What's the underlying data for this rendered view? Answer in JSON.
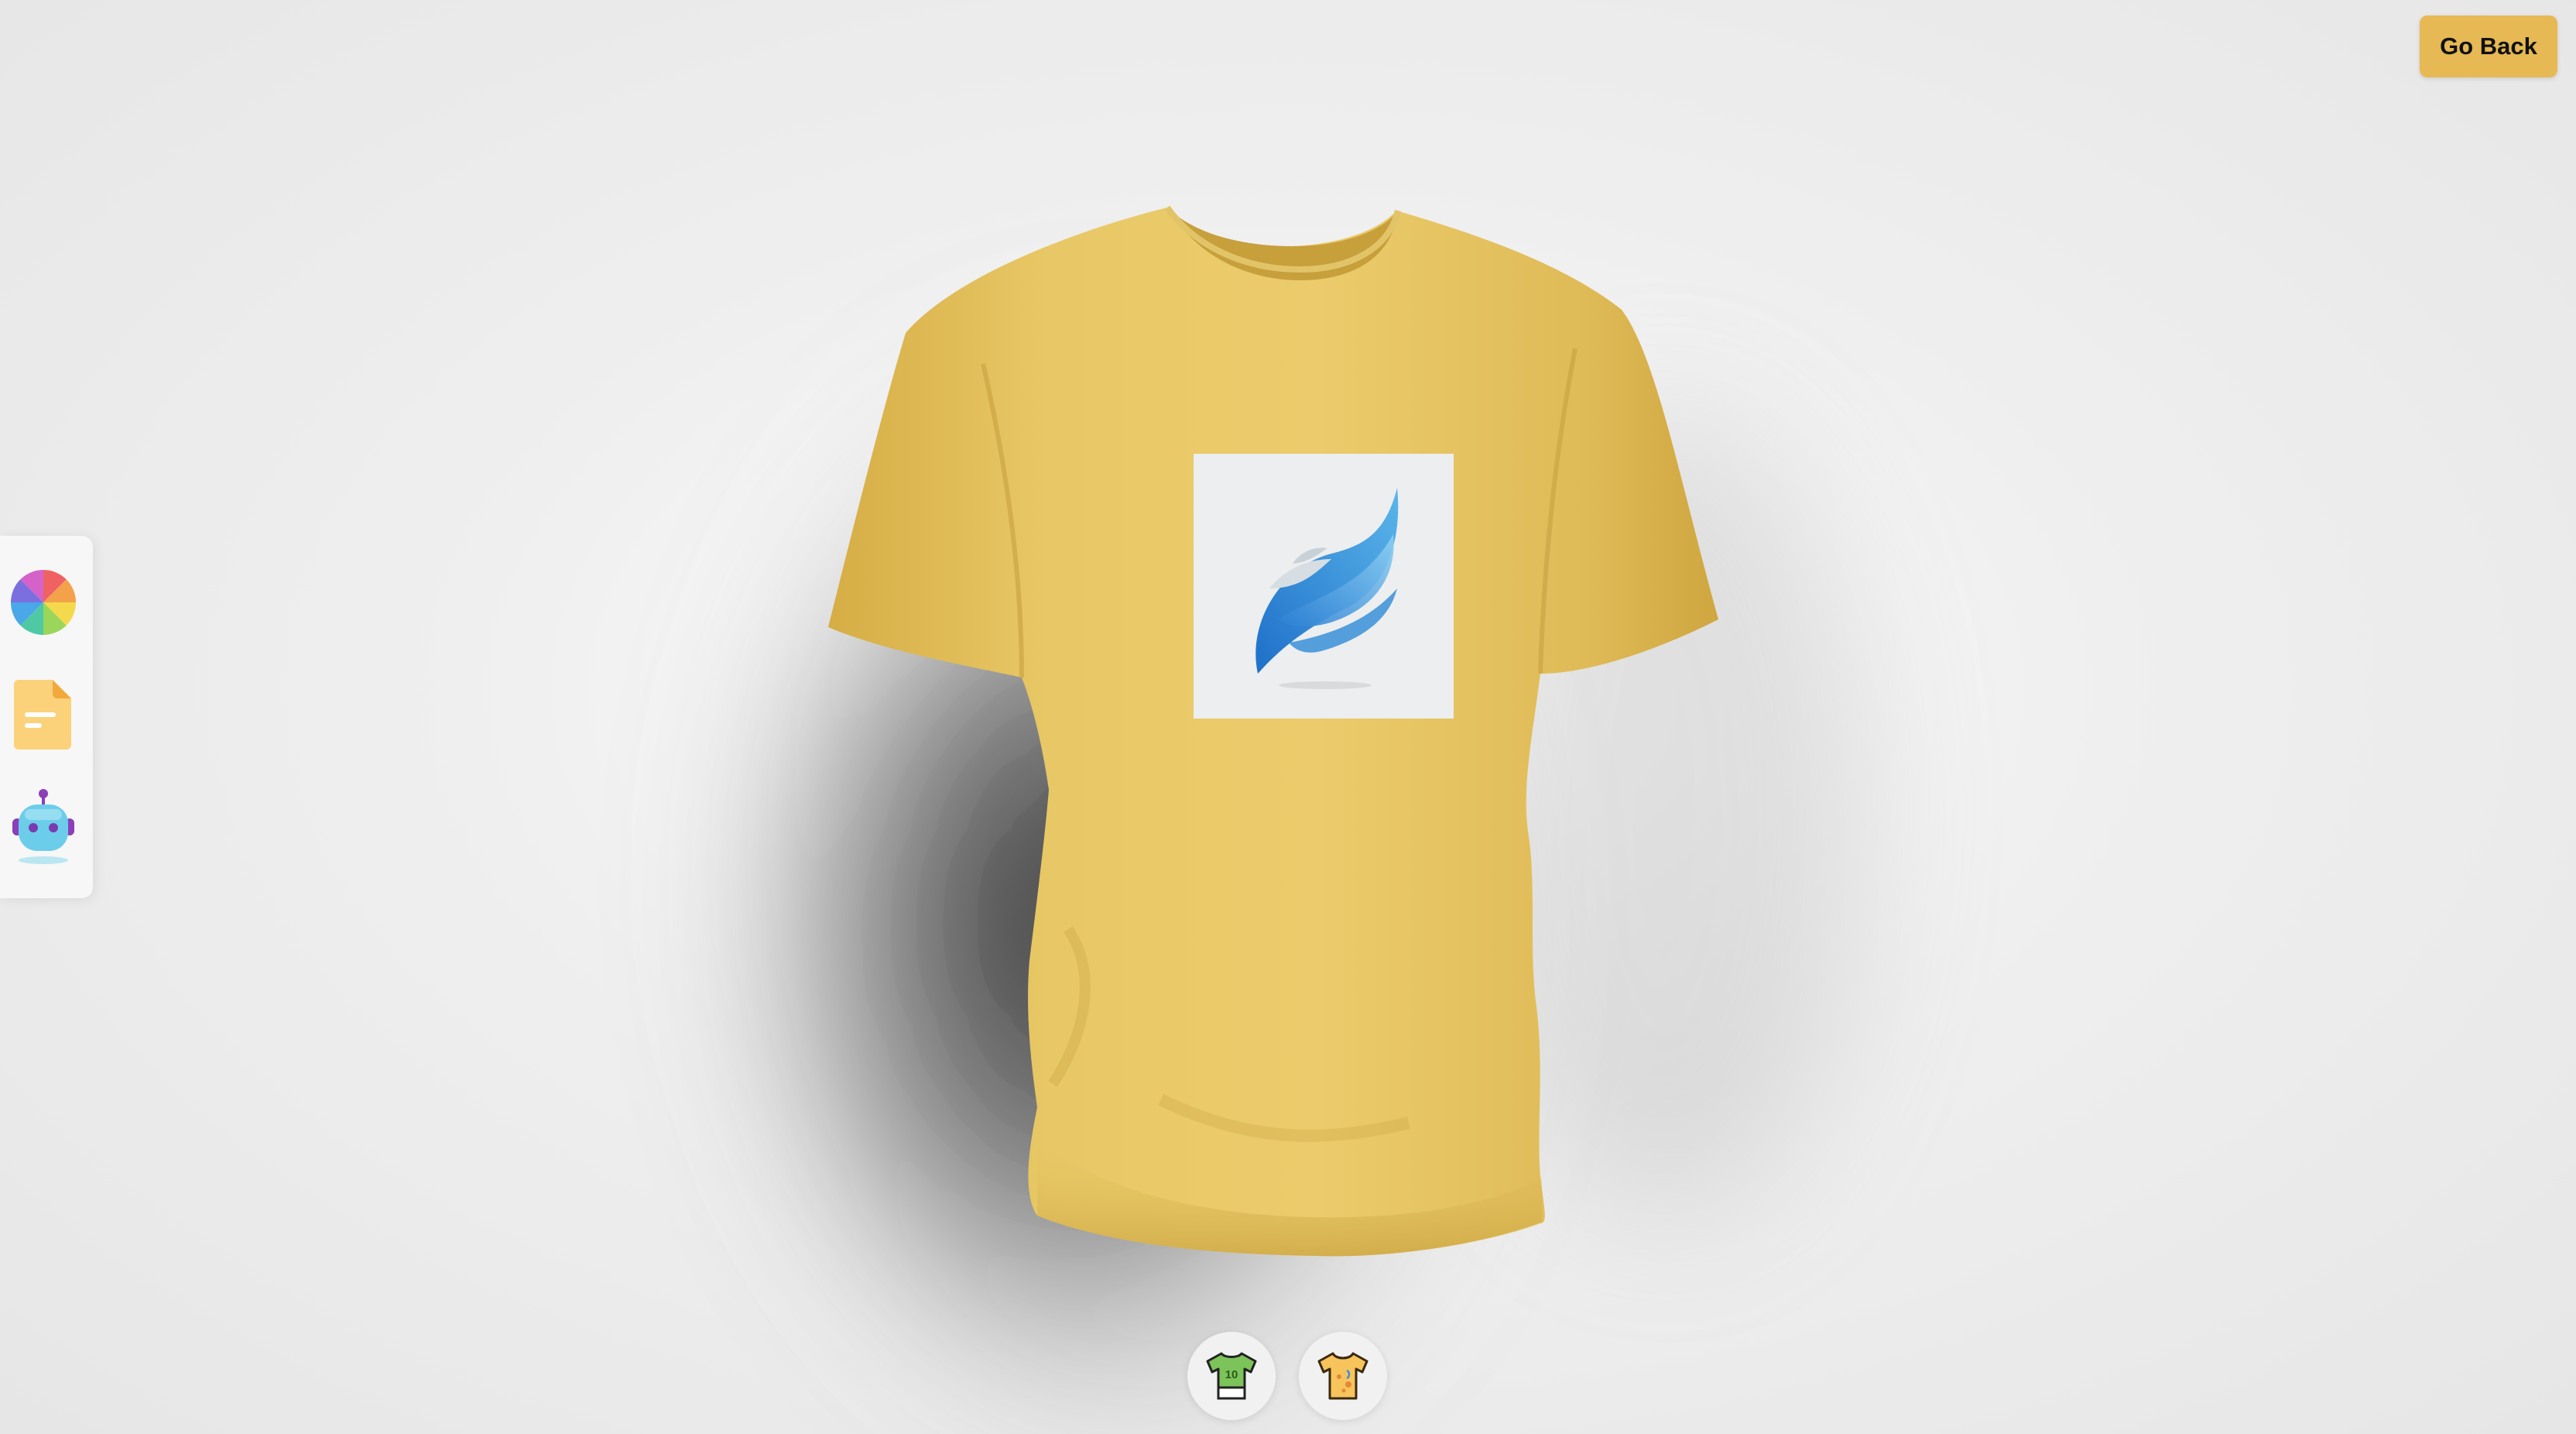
{
  "header": {
    "go_back_label": "Go Back"
  },
  "toolbar": {
    "items": [
      {
        "name": "colorpicker",
        "icon": "color-wheel-icon"
      },
      {
        "name": "filepicker",
        "icon": "file-icon"
      },
      {
        "name": "aipicker",
        "icon": "robot-icon"
      }
    ]
  },
  "filter_tabs": [
    {
      "name": "logo-shirt",
      "icon": "shirt-number-icon",
      "label": "10"
    },
    {
      "name": "stylish-shirt",
      "icon": "stylish-shirt-icon"
    }
  ],
  "shirt": {
    "color": "#e6c560",
    "decal_background": "#eceeef"
  },
  "colors": {
    "accent": "#e6b955",
    "toolbar_bg": "#f7f7f7"
  }
}
